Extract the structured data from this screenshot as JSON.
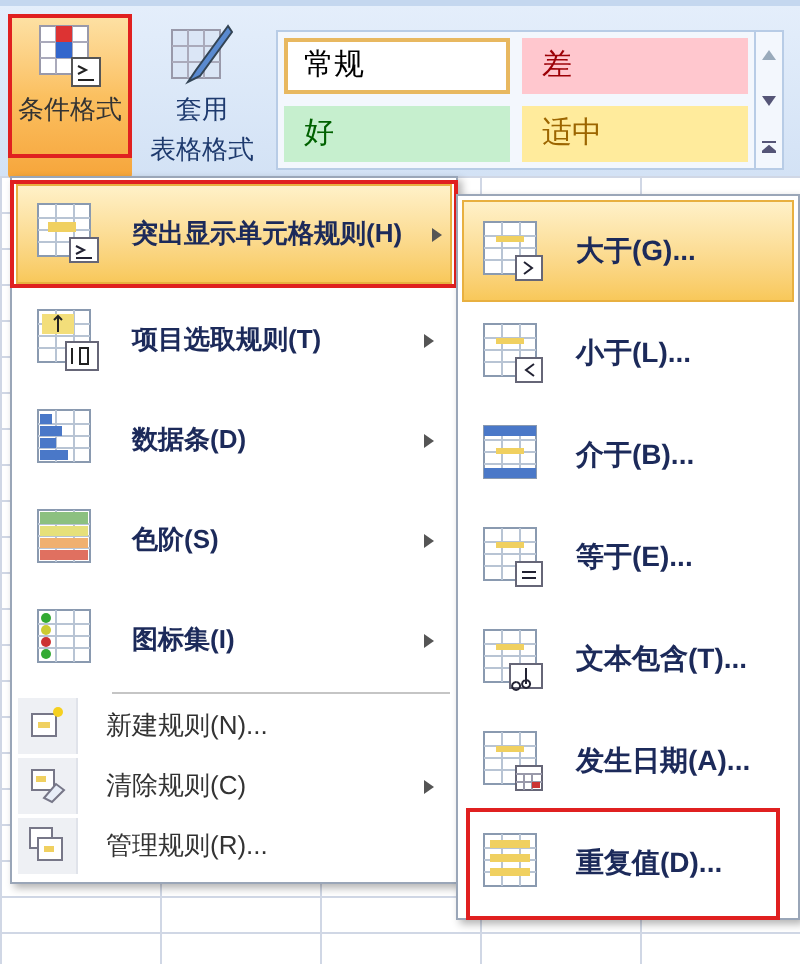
{
  "ribbon": {
    "buttons": [
      {
        "lines": [
          "条件格式"
        ],
        "annotated": true,
        "highlighted": true
      },
      {
        "lines": [
          "套用",
          "表格格式"
        ],
        "annotated": false,
        "highlighted": false
      }
    ],
    "styles": [
      {
        "label": "常规",
        "color": "#ffffff",
        "selected": true
      },
      {
        "label": "差",
        "color": "#ffc7ce",
        "selected": false
      },
      {
        "label": "好",
        "color": "#c6efce",
        "selected": false
      },
      {
        "label": "适中",
        "color": "#ffeb9c",
        "selected": false
      }
    ]
  },
  "menu": {
    "items": [
      {
        "kind": "large",
        "label": "突出显示单元格规则(H)",
        "submenu": true,
        "highlighted": true,
        "annotated": true
      },
      {
        "kind": "large",
        "label": "项目选取规则(T)",
        "submenu": true,
        "highlighted": false,
        "annotated": false
      },
      {
        "kind": "large",
        "label": "数据条(D)",
        "submenu": true,
        "highlighted": false,
        "annotated": false
      },
      {
        "kind": "large",
        "label": "色阶(S)",
        "submenu": true,
        "highlighted": false,
        "annotated": false
      },
      {
        "kind": "large",
        "label": "图标集(I)",
        "submenu": true,
        "highlighted": false,
        "annotated": false
      },
      {
        "kind": "small",
        "label": "新建规则(N)...",
        "submenu": false,
        "highlighted": false,
        "annotated": false
      },
      {
        "kind": "small",
        "label": "清除规则(C)",
        "submenu": true,
        "highlighted": false,
        "annotated": false
      },
      {
        "kind": "small",
        "label": "管理规则(R)...",
        "submenu": false,
        "highlighted": false,
        "annotated": false
      }
    ]
  },
  "submenu": {
    "items": [
      {
        "label": "大于(G)...",
        "highlighted": true,
        "annotated": false
      },
      {
        "label": "小于(L)...",
        "highlighted": false,
        "annotated": false
      },
      {
        "label": "介于(B)...",
        "highlighted": false,
        "annotated": false
      },
      {
        "label": "等于(E)...",
        "highlighted": false,
        "annotated": false
      },
      {
        "label": "文本包含(T)...",
        "highlighted": false,
        "annotated": false
      },
      {
        "label": "发生日期(A)...",
        "highlighted": false,
        "annotated": false
      },
      {
        "label": "重复值(D)...",
        "highlighted": false,
        "annotated": true
      }
    ]
  }
}
